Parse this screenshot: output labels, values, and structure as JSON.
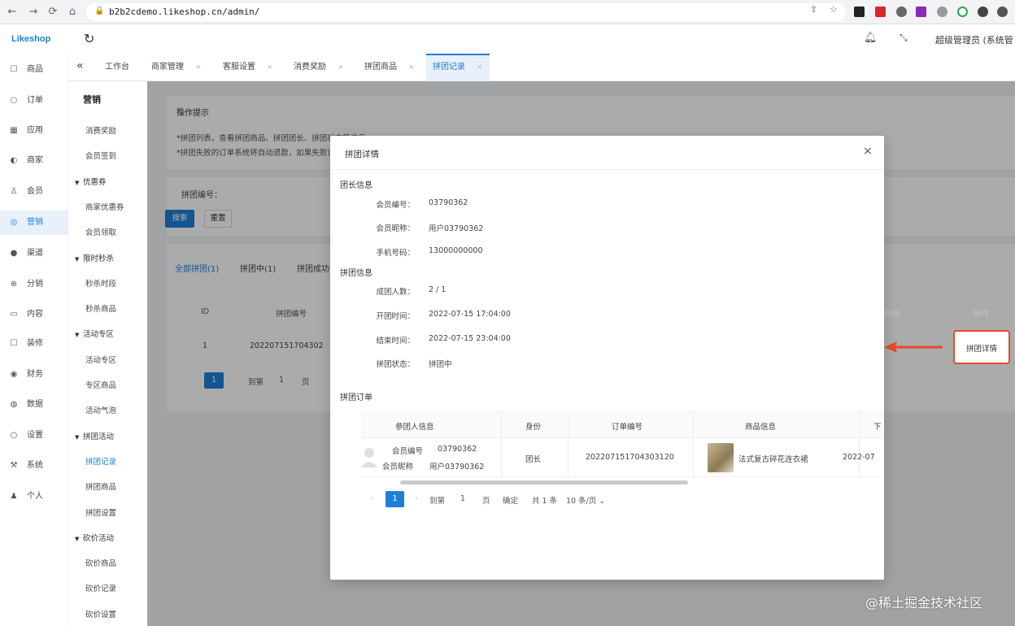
{
  "browser": {
    "url": "b2b2cdemo.likeshop.cn/admin/",
    "nav": [
      "←",
      "→",
      "⟳",
      "⌂"
    ]
  },
  "header": {
    "logo": "Likeshop",
    "user": "超级管理员 (系统管"
  },
  "main_nav": [
    {
      "icon": "☐",
      "label": "商品"
    },
    {
      "icon": "○",
      "label": "订单"
    },
    {
      "icon": "▦",
      "label": "应用"
    },
    {
      "icon": "◐",
      "label": "商家"
    },
    {
      "icon": "♙",
      "label": "会员"
    },
    {
      "icon": "◎",
      "label": "营销",
      "active": true
    },
    {
      "icon": "●",
      "label": "渠道"
    },
    {
      "icon": "⊕",
      "label": "分销"
    },
    {
      "icon": "▭",
      "label": "内容"
    },
    {
      "icon": "☐",
      "label": "装修"
    },
    {
      "icon": "◉",
      "label": "财务"
    },
    {
      "icon": "◍",
      "label": "数据"
    },
    {
      "icon": "○",
      "label": "设置"
    },
    {
      "icon": "⚒",
      "label": "系统"
    },
    {
      "icon": "♟",
      "label": "个人"
    }
  ],
  "sub_nav": {
    "title": "营销",
    "items": [
      {
        "type": "child",
        "label": "消费奖励"
      },
      {
        "type": "child",
        "label": "会员签到"
      },
      {
        "type": "group",
        "label": "优惠券"
      },
      {
        "type": "child",
        "label": "商家优惠券"
      },
      {
        "type": "child",
        "label": "会员领取"
      },
      {
        "type": "group",
        "label": "限时秒杀"
      },
      {
        "type": "child",
        "label": "秒杀时段"
      },
      {
        "type": "child",
        "label": "秒杀商品"
      },
      {
        "type": "group",
        "label": "活动专区"
      },
      {
        "type": "child",
        "label": "活动专区"
      },
      {
        "type": "child",
        "label": "专区商品"
      },
      {
        "type": "child",
        "label": "活动气泡"
      },
      {
        "type": "group",
        "label": "拼团活动"
      },
      {
        "type": "child",
        "label": "拼团记录",
        "active": true
      },
      {
        "type": "child",
        "label": "拼团商品"
      },
      {
        "type": "child",
        "label": "拼团设置"
      },
      {
        "type": "group",
        "label": "砍价活动"
      },
      {
        "type": "child",
        "label": "砍价商品"
      },
      {
        "type": "child",
        "label": "砍价记录"
      },
      {
        "type": "child",
        "label": "砍价设置"
      }
    ]
  },
  "tabs": [
    "工作台",
    "商家管理",
    "客服设置",
    "消费奖励",
    "拼团商品",
    "拼团记录"
  ],
  "content": {
    "tip_title": "操作提示",
    "tips": [
      "*拼团列表，查看拼团商品、拼团团长、拼团状态等信息",
      "*拼团失败的订单系统将自动退款，如果失败请联系技术"
    ],
    "filter_label": "拼团编号：",
    "search_btn": "搜索",
    "reset_btn": "重置",
    "list_tabs": [
      "全部拼团(1)",
      "拼团中(1)",
      "拼团成功"
    ],
    "table_headers": [
      "ID",
      "拼团编号"
    ],
    "row": [
      "1",
      "202207151704302"
    ],
    "right_headers": [
      "时间",
      "操作"
    ],
    "detail_btn": "拼团详情",
    "pager": [
      "1",
      "到第",
      "1",
      "页"
    ]
  },
  "modal": {
    "title": "拼团详情",
    "close": "×",
    "sections": {
      "leader": "团长信息",
      "group": "拼团信息",
      "orders": "拼团订单"
    },
    "leader_info": [
      {
        "label": "会员编号：",
        "value": "03790362"
      },
      {
        "label": "会员昵称：",
        "value": "用户03790362"
      },
      {
        "label": "手机号码：",
        "value": "13000000000"
      }
    ],
    "group_info": [
      {
        "label": "成团人数：",
        "value": "2 / 1"
      },
      {
        "label": "开团时间：",
        "value": "2022-07-15 17:04:00"
      },
      {
        "label": "结束时间：",
        "value": "2022-07-15 23:04:00"
      },
      {
        "label": "拼团状态：",
        "value": "拼团中"
      }
    ],
    "order_headers": [
      "参团人信息",
      "身份",
      "订单编号",
      "商品信息",
      "下"
    ],
    "order_row": {
      "member_no_label": "会员编号",
      "member_no": "03790362",
      "nickname_label": "会员昵称",
      "nickname": "用户03790362",
      "role": "团长",
      "order_no": "202207151704303120",
      "product": "法式复古碎花连衣裙",
      "time": "2022-07"
    },
    "pager": {
      "current": "1",
      "goto": "到第",
      "page_input": "1",
      "page_unit": "页",
      "confirm": "确定",
      "total": "共 1 条",
      "size": "10 条/页 ⌄"
    }
  },
  "watermark": "@稀土掘金技术社区"
}
